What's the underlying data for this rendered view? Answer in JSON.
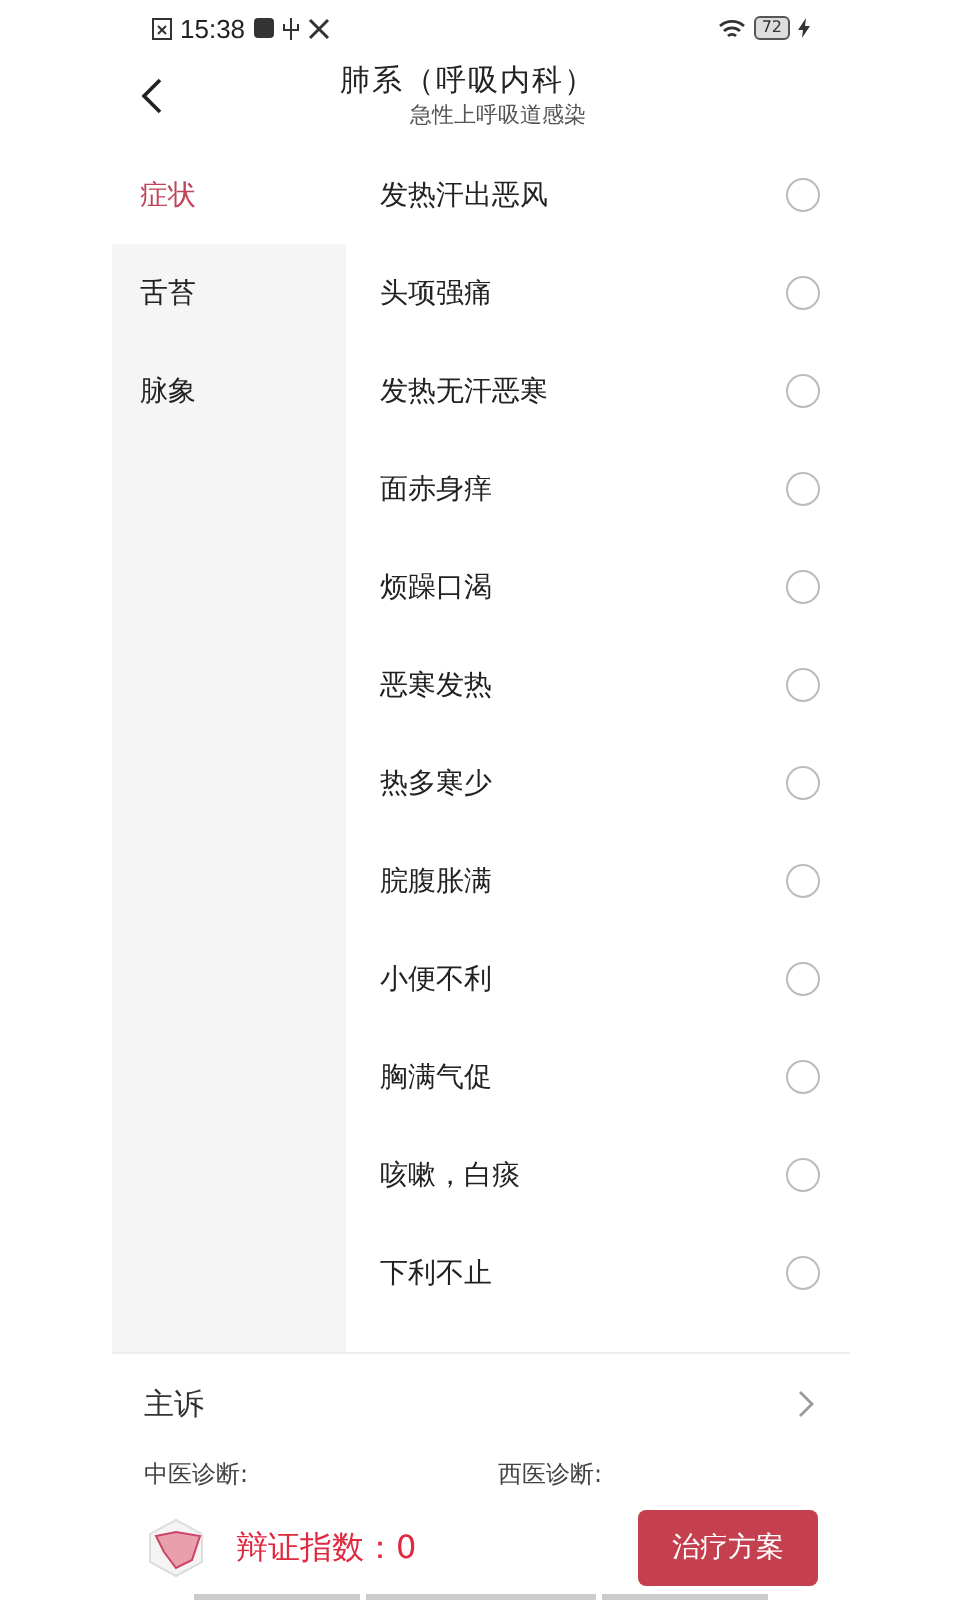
{
  "status_bar": {
    "time": "15:38",
    "battery": "72"
  },
  "header": {
    "title": "肺系（呼吸内科）",
    "subtitle": "急性上呼吸道感染"
  },
  "sidebar": {
    "items": [
      {
        "label": "症状",
        "selected": true
      },
      {
        "label": "舌苔",
        "selected": false
      },
      {
        "label": "脉象",
        "selected": false
      }
    ]
  },
  "symptoms": [
    {
      "label": "发热汗出恶风",
      "checked": false
    },
    {
      "label": "头项强痛",
      "checked": false
    },
    {
      "label": "发热无汗恶寒",
      "checked": false
    },
    {
      "label": "面赤身痒",
      "checked": false
    },
    {
      "label": "烦躁口渴",
      "checked": false
    },
    {
      "label": "恶寒发热",
      "checked": false
    },
    {
      "label": "热多寒少",
      "checked": false
    },
    {
      "label": "脘腹胀满",
      "checked": false
    },
    {
      "label": "小便不利",
      "checked": false
    },
    {
      "label": "胸满气促",
      "checked": false
    },
    {
      "label": "咳嗽，白痰",
      "checked": false
    },
    {
      "label": "下利不止",
      "checked": false
    }
  ],
  "complaint": {
    "label": "主诉"
  },
  "diagnosis": {
    "tcm": "中医诊断:",
    "western": "西医诊断:"
  },
  "footer": {
    "score": "辩证指数：0",
    "button": "治疗方案"
  }
}
